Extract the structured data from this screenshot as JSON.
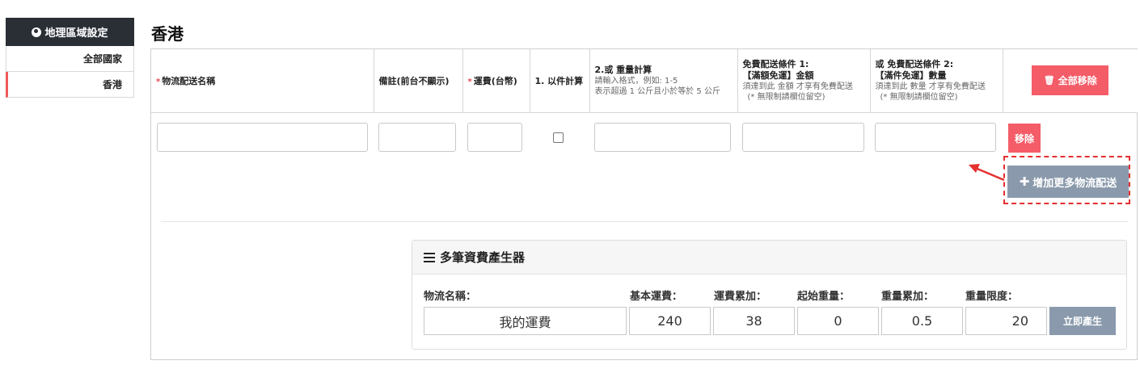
{
  "sidebar": {
    "header": "地理區域設定",
    "items": [
      {
        "label": "全部國家"
      },
      {
        "label": "香港"
      }
    ]
  },
  "page": {
    "title": "香港"
  },
  "table": {
    "col_name": "物流配送名稱",
    "col_note": "備註(前台不顯示)",
    "col_fee": "運費(台幣)",
    "col_per_item": "1. 以件計算",
    "col_weight_title": "2.或 重量計算",
    "col_weight_sub1": "請輸入格式，例如: 1-5",
    "col_weight_sub2": "表示超過 1 公斤且小於等於 5 公斤",
    "col_free1_title": "免費配送條件 1:",
    "col_free1_title2": "【滿額免運】金額",
    "col_free1_sub1": "須達到此 金額 才享有免費配送",
    "col_free1_sub2": "(* 無限制請欄位留空)",
    "col_free2_title": "或 免費配送條件 2:",
    "col_free2_title2": "【滿件免運】數量",
    "col_free2_sub1": "須達到此 數量 才享有免費配送",
    "col_free2_sub2": "(* 無限制請欄位留空)",
    "remove_all_label": "全部移除",
    "required_mark": "*"
  },
  "row": {
    "remove_label": "移除"
  },
  "add_more_label": "增加更多物流配送",
  "generator": {
    "title": "多筆資費產生器",
    "labels": {
      "name": "物流名稱：",
      "base_fee": "基本運費：",
      "fee_increment": "運費累加：",
      "start_weight": "起始重量：",
      "weight_increment": "重量累加：",
      "weight_limit": "重量限度："
    },
    "values": {
      "name": "我的運費",
      "base_fee": "240",
      "fee_increment": "38",
      "start_weight": "0",
      "weight_increment": "0.5",
      "weight_limit": "20"
    },
    "generate_label": "立即產生"
  },
  "colors": {
    "accent_red": "#f45c68",
    "grey_button": "#8a9aac",
    "sidebar_dark": "#2a2f36",
    "annotation": "#e53030"
  }
}
